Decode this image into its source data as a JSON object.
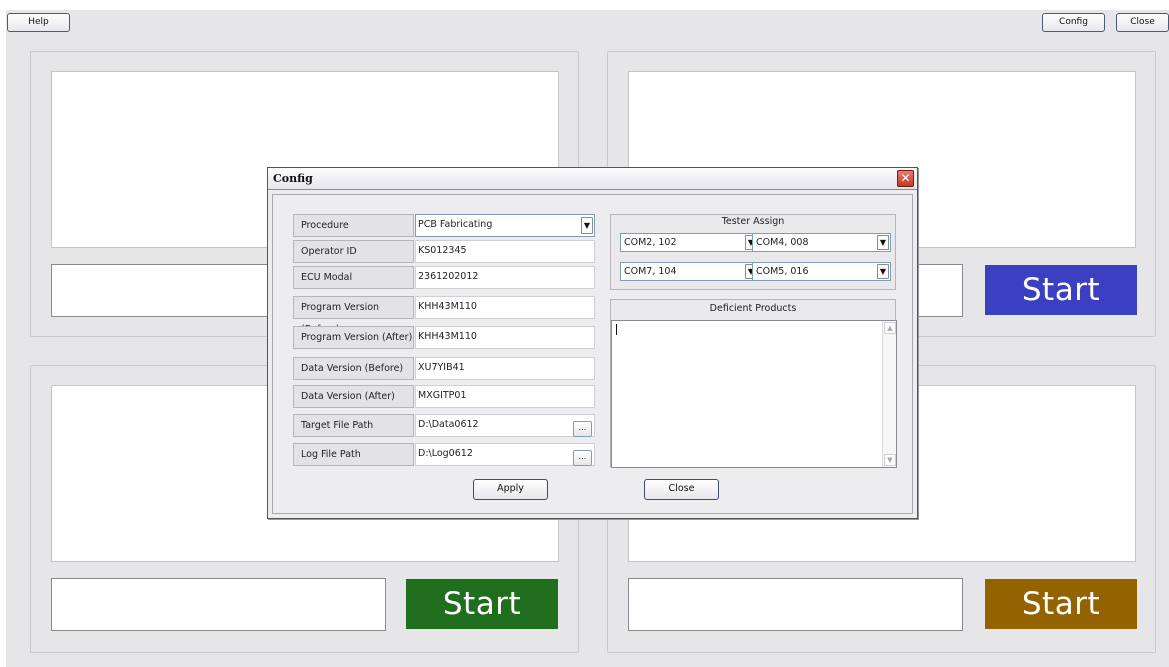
{
  "toolbar": {
    "help_label": "Help",
    "config_label": "Config",
    "close_label": "Close"
  },
  "stations": [
    {
      "start_label": "Start",
      "color": "#3b3fc2",
      "result_text": ""
    },
    {
      "start_label": "Start",
      "color": "#1e6e1e",
      "result_text": ""
    },
    {
      "start_label": "Start",
      "color": "#956200",
      "result_text": ""
    }
  ],
  "dialog": {
    "title": "Config",
    "close_icon": "close-x-icon",
    "fields": [
      {
        "label": "Procedure",
        "value": "PCB Fabricating"
      },
      {
        "label": "Operator ID",
        "value": "KS012345"
      },
      {
        "label": "ECU Modal",
        "value": "2361202012"
      },
      {
        "label": "Program Version (Before)",
        "value": "KHH43M110"
      },
      {
        "label": "Program Version (After)",
        "value": "KHH43M110"
      },
      {
        "label": "Data Version (Before)",
        "value": "XU7YIB41"
      },
      {
        "label": "Data Version (After)",
        "value": "MXGITP01"
      },
      {
        "label": "Target File Path",
        "value": "D:\\Data0612"
      },
      {
        "label": "Log File Path",
        "value": "D:\\Log0612"
      }
    ],
    "browse_label": "...",
    "tester_assign": {
      "title": "Tester Assign",
      "ports": [
        "COM2, 102",
        "COM4, 008",
        "COM7, 104",
        "COM5, 016"
      ]
    },
    "deficient_products": {
      "title": "Deficient Products",
      "text": ""
    },
    "apply_label": "Apply",
    "close_label": "Close"
  }
}
